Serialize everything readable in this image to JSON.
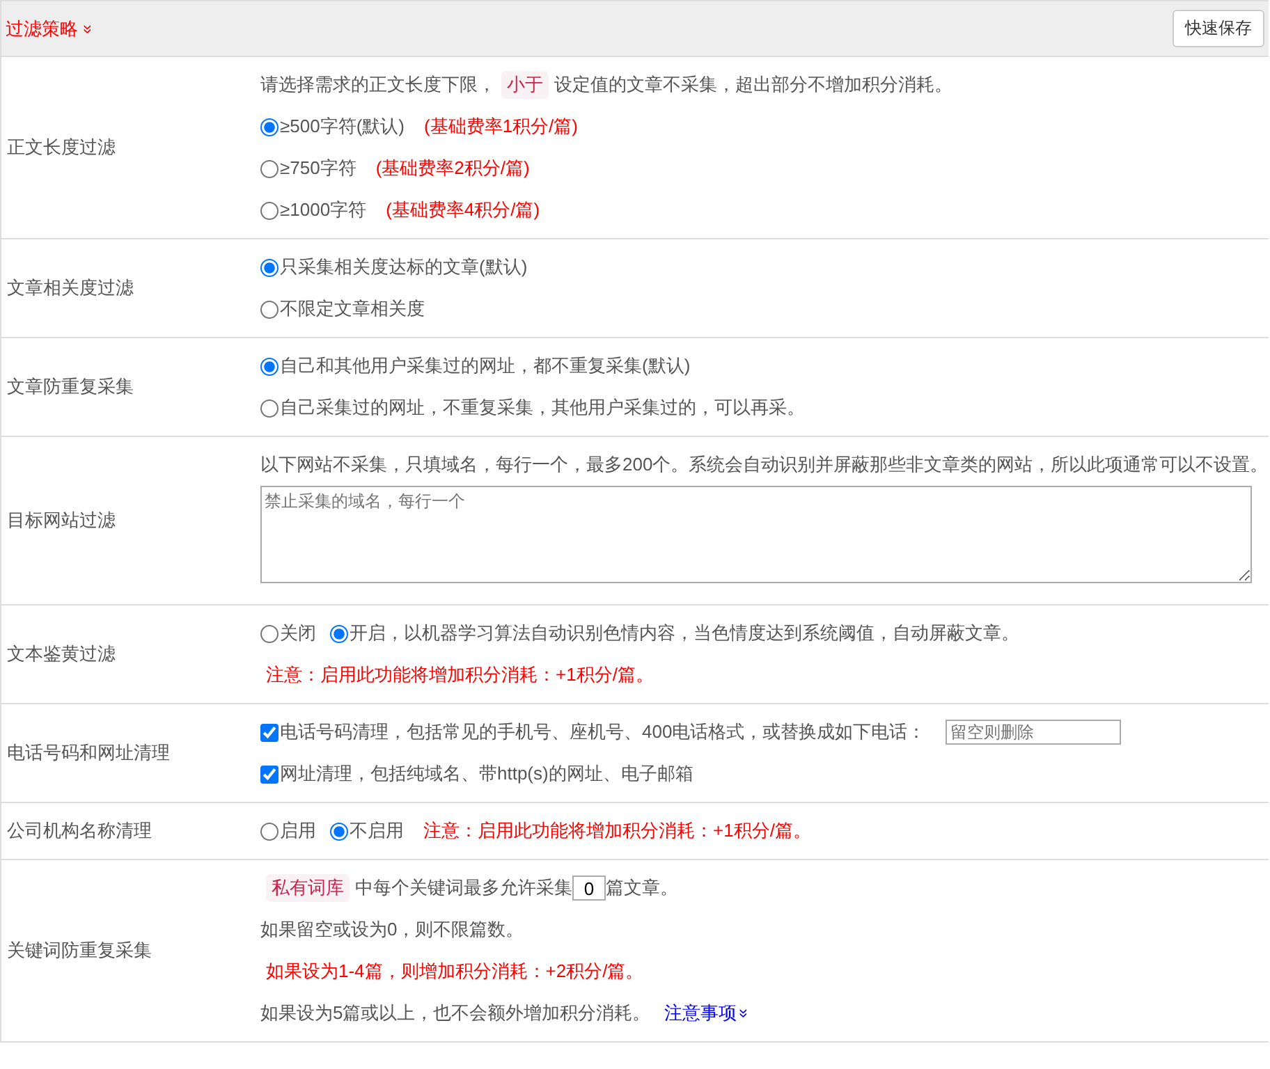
{
  "header": {
    "title": "过滤策略",
    "chevron": "»",
    "save_button": "快速保存"
  },
  "rows": [
    {
      "label": "正文长度过滤",
      "lines": [
        [
          {
            "kind": "plain",
            "text": "请选择需求的正文长度下限，"
          },
          {
            "kind": "tag",
            "text": "小于"
          },
          {
            "kind": "plain",
            "text": "设定值的文章不采集，超出部分不增加积分消耗。"
          }
        ],
        [
          {
            "kind": "radio",
            "label": "≥500字符(默认)",
            "selected": true
          },
          {
            "kind": "note",
            "text": "(基础费率1积分/篇)"
          }
        ],
        [
          {
            "kind": "radio",
            "label": "≥750字符",
            "selected": false
          },
          {
            "kind": "note",
            "text": "(基础费率2积分/篇)"
          }
        ],
        [
          {
            "kind": "radio",
            "label": "≥1000字符",
            "selected": false
          },
          {
            "kind": "note",
            "text": "(基础费率4积分/篇)"
          }
        ]
      ]
    },
    {
      "label": "文章相关度过滤",
      "lines": [
        [
          {
            "kind": "radio",
            "label": "只采集相关度达标的文章(默认)",
            "selected": true
          }
        ],
        [
          {
            "kind": "radio",
            "label": "不限定文章相关度",
            "selected": false
          }
        ]
      ]
    },
    {
      "label": "文章防重复采集",
      "lines": [
        [
          {
            "kind": "radio",
            "label": "自己和其他用户采集过的网址，都不重复采集(默认)",
            "selected": true
          }
        ],
        [
          {
            "kind": "radio",
            "label": "自己采集过的网址，不重复采集，其他用户采集过的，可以再采。",
            "selected": false
          }
        ]
      ]
    },
    {
      "label": "目标网站过滤",
      "lines": [
        [
          {
            "kind": "plain",
            "text": "以下网站不采集，只填域名，每行一个，最多200个。系统会自动识别并屏蔽那些非文章类的网站，所以此项通常可以不设置。"
          }
        ],
        [
          {
            "kind": "textarea",
            "placeholder": "禁止采集的域名，每行一个"
          }
        ]
      ]
    },
    {
      "label": "文本鉴黄过滤",
      "lines": [
        [
          {
            "kind": "radio",
            "label": "关闭",
            "selected": false
          },
          {
            "kind": "radio",
            "label": "开启，以机器学习算法自动识别色情内容，当色情度达到系统阈值，自动屏蔽文章。",
            "selected": true
          }
        ],
        [
          {
            "kind": "note",
            "text": "注意：启用此功能将增加积分消耗：+1积分/篇。"
          }
        ]
      ]
    },
    {
      "label": "电话号码和网址清理",
      "lines": [
        [
          {
            "kind": "checkbox",
            "label": "电话号码清理，包括常见的手机号、座机号、400电话格式，或替换成如下电话：",
            "checked": true
          },
          {
            "kind": "text-field",
            "placeholder": "留空则删除"
          }
        ],
        [
          {
            "kind": "checkbox",
            "label": "网址清理，包括纯域名、带http(s)的网址、电子邮箱",
            "checked": true
          }
        ]
      ]
    },
    {
      "label": "公司机构名称清理",
      "lines": [
        [
          {
            "kind": "radio",
            "label": "启用",
            "selected": false
          },
          {
            "kind": "radio",
            "label": "不启用",
            "selected": true
          },
          {
            "kind": "note",
            "text": "注意：启用此功能将增加积分消耗：+1积分/篇。"
          }
        ]
      ]
    },
    {
      "label": "关键词防重复采集",
      "lines": [
        [
          {
            "kind": "tag",
            "text": "私有词库"
          },
          {
            "kind": "plain",
            "text": "中每个关键词最多允许采集"
          },
          {
            "kind": "number-field",
            "value": "0"
          },
          {
            "kind": "plain",
            "text": "篇文章。"
          }
        ],
        [
          {
            "kind": "plain",
            "text": "如果留空或设为0，则不限篇数。"
          }
        ],
        [
          {
            "kind": "note",
            "text": "如果设为1-4篇，则增加积分消耗：+2积分/篇。"
          }
        ],
        [
          {
            "kind": "plain",
            "text": "如果设为5篇或以上，也不会额外增加积分消耗。"
          },
          {
            "kind": "link",
            "text": "注意事项",
            "chevron": "»"
          }
        ]
      ]
    }
  ]
}
